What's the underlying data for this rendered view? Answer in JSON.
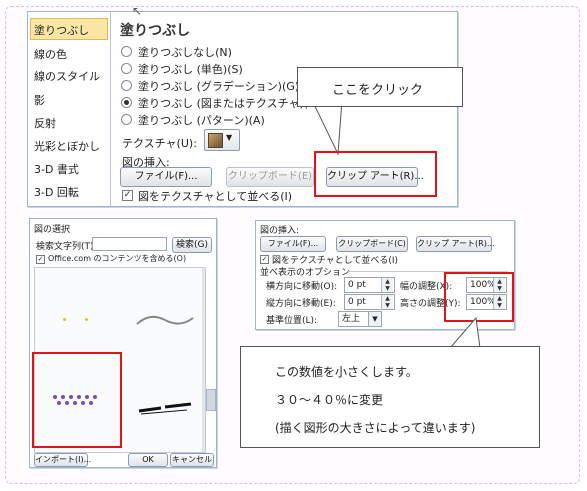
{
  "fill_dialog": {
    "sidebar": [
      "塗りつぶし",
      "線の色",
      "線のスタイル",
      "影",
      "反射",
      "光彩とぼかし",
      "3-D 書式",
      "3-D 回転"
    ],
    "title": "塗りつぶし",
    "options": [
      "塗りつぶしなし(N)",
      "塗りつぶし (単色)(S)",
      "塗りつぶし (グラデーション)(G)",
      "塗りつぶし (図またはテクスチャ)(P)",
      "塗りつぶし (パターン)(A)"
    ],
    "texture_label": "テクスチャ(U):",
    "insert_label": "図の挿入:",
    "file_button": "ファイル(F)...",
    "clipboard_button": "クリップボード(E)",
    "clipart_button": "クリップ アート(R)...",
    "tile_checkbox": "図をテクスチャとして並べる(I)"
  },
  "callout_top": "ここをクリック",
  "picker": {
    "title": "図の選択",
    "search_label": "検索文字列(T):",
    "search_button": "検索(G)",
    "officecom_checkbox": "Office.com のコンテンツを含める(O)",
    "import_button": "インポート(I)...",
    "ok_button": "OK",
    "cancel_button": "キャンセル"
  },
  "settings": {
    "insert_label": "図の挿入:",
    "file_button": "ファイル(F)...",
    "clipboard_button": "クリップボード(C)",
    "clipart_button": "クリップ アート(R)...",
    "tile_checkbox": "図をテクスチャとして並べる(I)",
    "tiling_group": "並べ表示のオプション",
    "offset_x_label": "横方向に移動(O):",
    "offset_x_value": "0 pt",
    "offset_y_label": "縦方向に移動(E):",
    "offset_y_value": "0 pt",
    "scale_x_label": "幅の調整(X):",
    "scale_x_value": "100%",
    "scale_y_label": "高さの調整(Y):",
    "scale_y_value": "100%",
    "align_label": "基準位置(L):",
    "align_value": "左上"
  },
  "callout_bottom": {
    "line1": "この数値を小さくします。",
    "line2": "３０～４０％に変更",
    "line3": "(描く図形の大きさによって違います)"
  },
  "colors": {
    "highlight": "#e0141b",
    "sidebar_selected": "#fbe6a3",
    "border": "#9cb3d1"
  }
}
